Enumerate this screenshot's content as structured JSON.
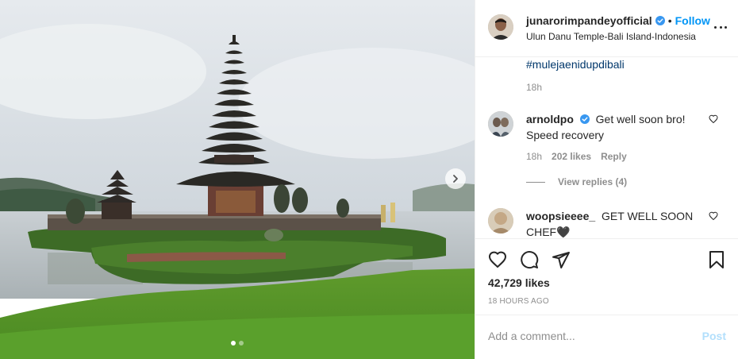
{
  "post": {
    "username": "junarorimpandeyofficial",
    "separator": "•",
    "follow_label": "Follow",
    "location": "Ulun Danu Temple-Bali Island-Indonesia",
    "more_icon": "more-options-icon"
  },
  "caption": {
    "hashtag": "#mulejaenidupdibali",
    "time": "18h"
  },
  "comments": [
    {
      "username": "arnoldpo",
      "verified": true,
      "text": "Get well soon bro! Speed recovery",
      "time": "18h",
      "likes": "202 likes",
      "reply_label": "Reply",
      "view_replies": "View replies (4)"
    },
    {
      "username": "woopsieeee_",
      "verified": false,
      "text": "GET WELL SOON CHEF🖤"
    }
  ],
  "actions": {
    "likes": "42,729 likes",
    "time_ago": "18 HOURS AGO"
  },
  "add_comment": {
    "placeholder": "Add a comment...",
    "post_label": "Post"
  },
  "colors": {
    "accent": "#0095f6",
    "post_disabled": "#b2dffc",
    "meta_text": "#8e8e8e",
    "hashtag": "#00376b"
  },
  "carousel": {
    "current": 1,
    "total": 2
  }
}
